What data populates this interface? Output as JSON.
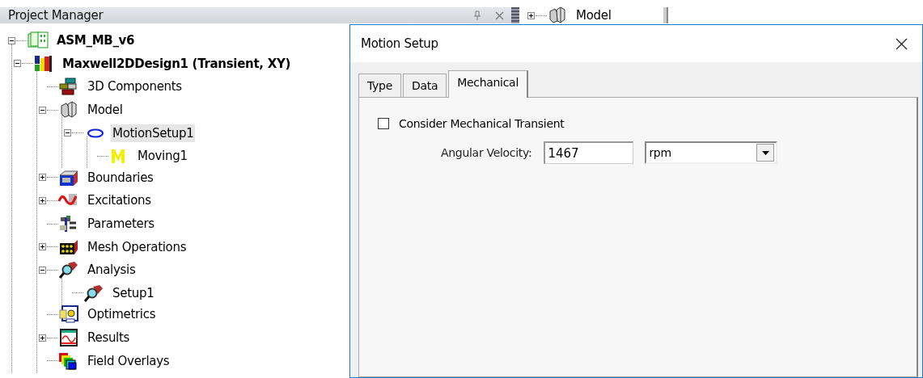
{
  "project_manager": {
    "title": "Project Manager",
    "tree": [
      {
        "label": "ASM_MB_v6",
        "kind": "project",
        "expanded": true,
        "selected": false,
        "children": [
          {
            "label": "Maxwell2DDesign1 (Transient, XY)",
            "kind": "design",
            "expanded": true,
            "selected": false,
            "children": [
              {
                "label": "3D Components",
                "kind": "components",
                "selected": false
              },
              {
                "label": "Model",
                "kind": "model",
                "expanded": true,
                "selected": false,
                "children": [
                  {
                    "label": "MotionSetup1",
                    "kind": "motion",
                    "expanded": true,
                    "selected": true,
                    "children": [
                      {
                        "label": "Moving1",
                        "kind": "moving",
                        "selected": false
                      }
                    ]
                  }
                ]
              },
              {
                "label": "Boundaries",
                "kind": "boundaries",
                "expanded": false,
                "selected": false
              },
              {
                "label": "Excitations",
                "kind": "excitations",
                "expanded": false,
                "selected": false
              },
              {
                "label": "Parameters",
                "kind": "parameters",
                "selected": false
              },
              {
                "label": "Mesh Operations",
                "kind": "mesh",
                "expanded": false,
                "selected": false
              },
              {
                "label": "Analysis",
                "kind": "analysis",
                "expanded": true,
                "selected": false,
                "children": [
                  {
                    "label": "Setup1",
                    "kind": "analysis",
                    "selected": false
                  }
                ]
              },
              {
                "label": "Optimetrics",
                "kind": "optimetrics",
                "selected": false
              },
              {
                "label": "Results",
                "kind": "results",
                "expanded": false,
                "selected": false
              },
              {
                "label": "Field Overlays",
                "kind": "overlays",
                "selected": false
              }
            ]
          }
        ]
      }
    ]
  },
  "side_panel": {
    "tree": [
      {
        "label": "Model",
        "kind": "model",
        "expanded": false,
        "selected": false
      }
    ]
  },
  "dialog": {
    "title": "Motion Setup",
    "tabs": [
      {
        "label": "Type",
        "selected": false
      },
      {
        "label": "Data",
        "selected": false
      },
      {
        "label": "Mechanical",
        "selected": true
      }
    ],
    "checkbox": {
      "label": "Consider Mechanical Transient",
      "checked": false
    },
    "field": {
      "label": "Angular Velocity:",
      "value": "1467"
    },
    "dropdown": {
      "value": "rpm"
    }
  }
}
